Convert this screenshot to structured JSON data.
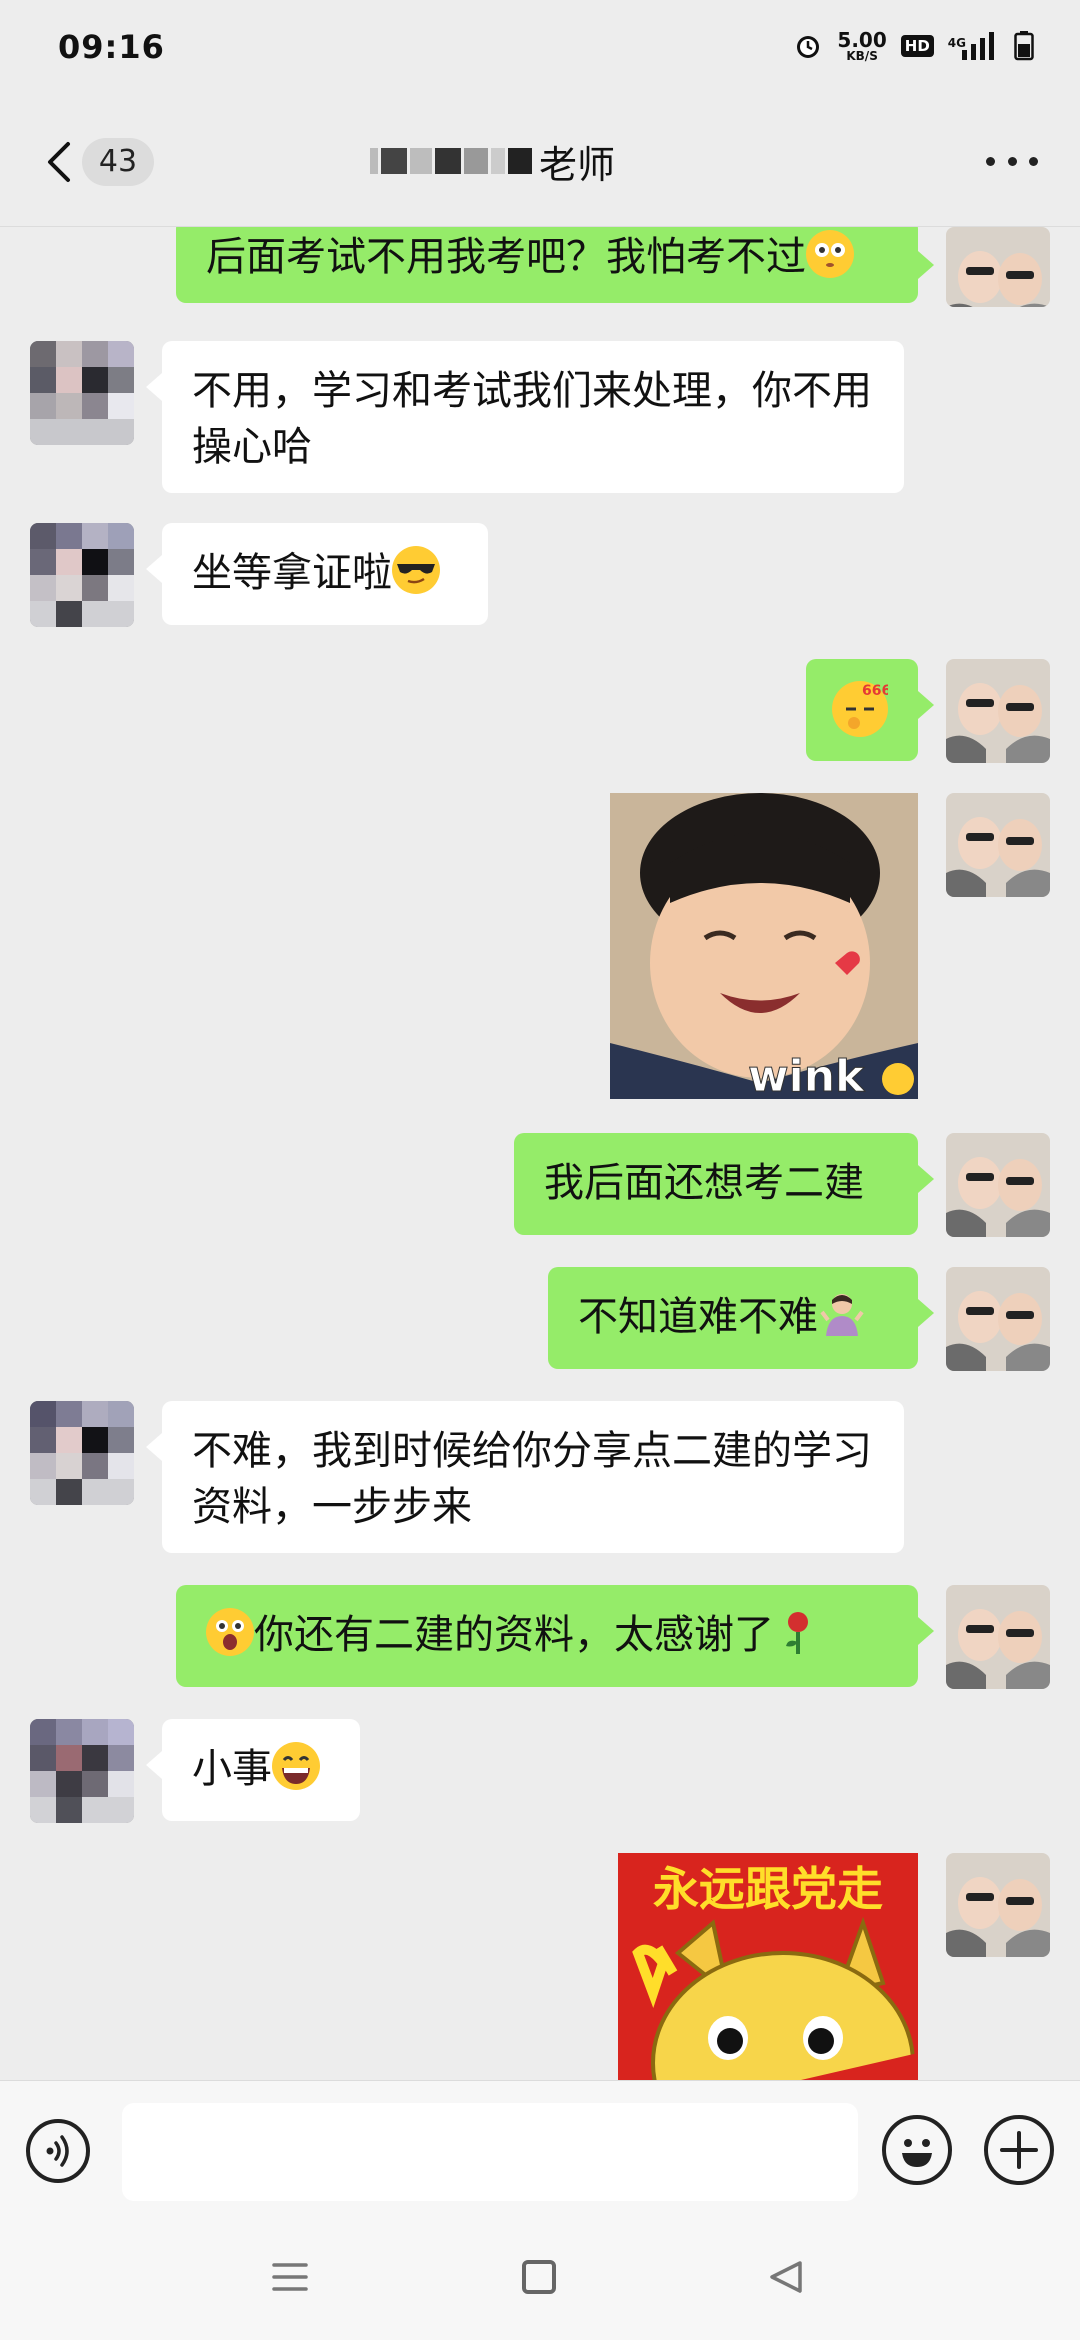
{
  "status_bar": {
    "time": "09:16",
    "net_speed_value": "5.00",
    "net_speed_unit": "KB/S",
    "hd": "HD",
    "network": "4G"
  },
  "header": {
    "unread_count": "43",
    "title_visible": "老师"
  },
  "messages": [
    {
      "side": "out",
      "text": "后面考试不用我考吧？我怕考不过",
      "emoji": "flushed-face"
    },
    {
      "side": "in",
      "text": "不用，学习和考试我们来处理，你不用操心哈"
    },
    {
      "side": "in",
      "text": "坐等拿证啦",
      "emoji": "sunglasses-face"
    },
    {
      "side": "out",
      "text": "",
      "emoji": "666-thinking-face"
    },
    {
      "side": "out",
      "sticker": "baby-wink-sticker",
      "sticker_text": "wink"
    },
    {
      "side": "out",
      "text": "我后面还想考二建"
    },
    {
      "side": "out",
      "text": "不知道难不难",
      "emoji": "shrug-person"
    },
    {
      "side": "in",
      "text": "不难，我到时候给你分享点二建的学习资料，一步步来"
    },
    {
      "side": "out",
      "text": "你还有二建的资料，太感谢了",
      "emoji_lead": "surprised-face",
      "emoji": "rose"
    },
    {
      "side": "in",
      "text": "小事",
      "emoji": "grinning-face"
    },
    {
      "side": "out",
      "sticker": "doge-sticker",
      "sticker_text": "永远跟党走"
    }
  ],
  "input": {
    "placeholder": ""
  },
  "colors": {
    "outgoing_bubble": "#95ec69",
    "incoming_bubble": "#ffffff",
    "background": "#ededed"
  }
}
